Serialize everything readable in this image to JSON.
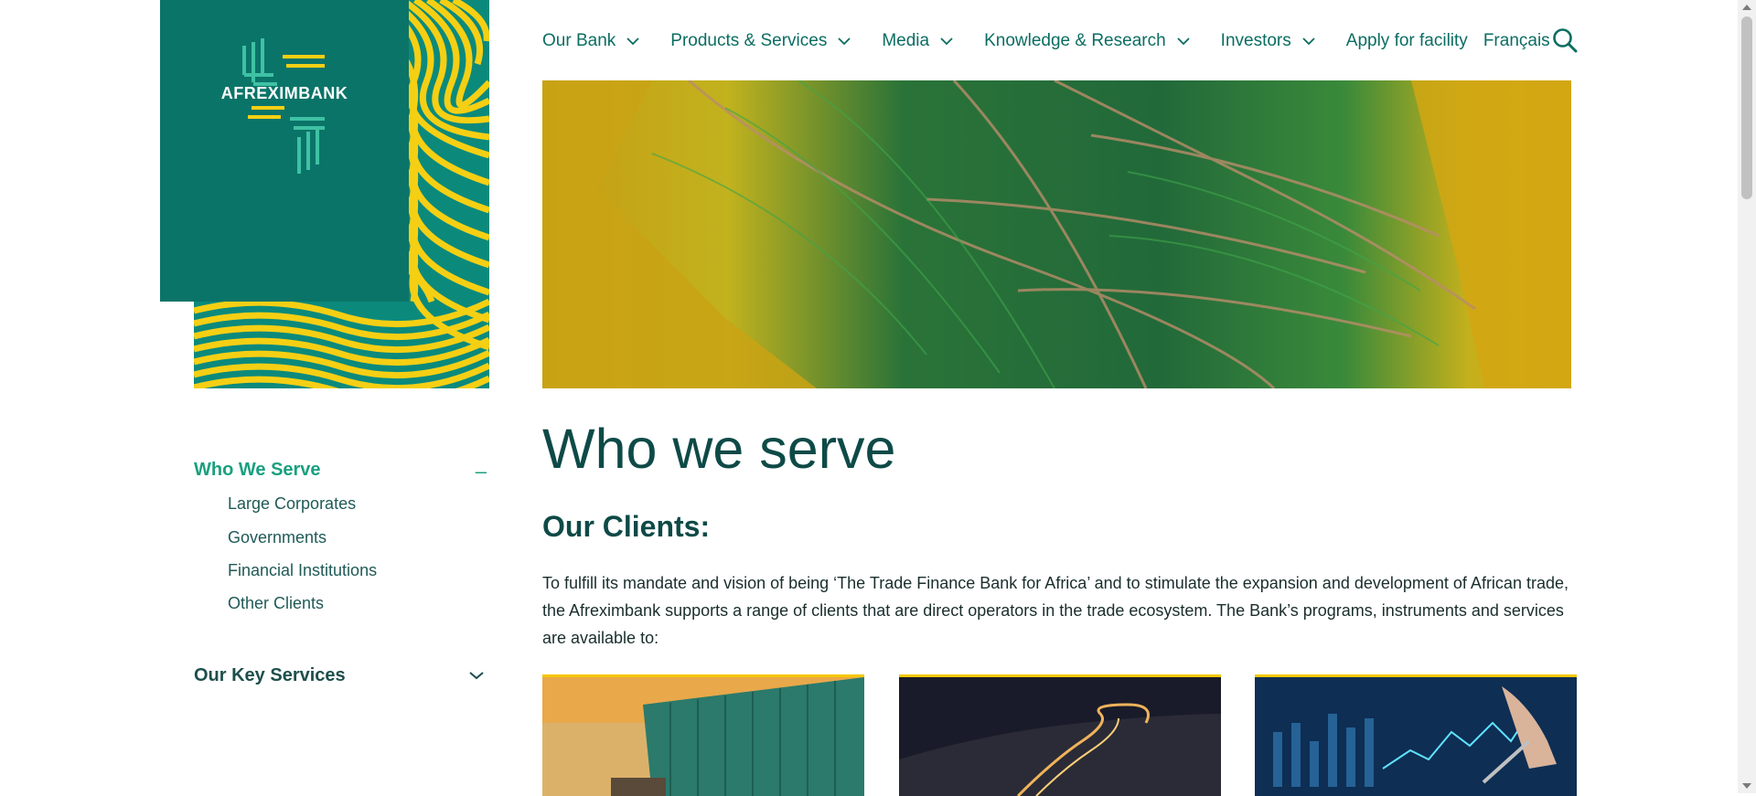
{
  "brand": {
    "name": "AFREXIMBANK"
  },
  "nav": {
    "items": [
      {
        "label": "Our Bank",
        "has_dropdown": true
      },
      {
        "label": "Products & Services",
        "has_dropdown": true
      },
      {
        "label": "Media",
        "has_dropdown": true
      },
      {
        "label": "Knowledge & Research",
        "has_dropdown": true
      },
      {
        "label": "Investors",
        "has_dropdown": true
      },
      {
        "label": "Apply for facility",
        "has_dropdown": false
      },
      {
        "label": "Français",
        "has_dropdown": false
      }
    ],
    "search_icon": "search-icon"
  },
  "sidebar": {
    "section1": {
      "title": "Who We Serve",
      "toggle": "–",
      "items": [
        "Large Corporates",
        "Governments",
        "Financial Institutions",
        "Other Clients"
      ]
    },
    "section2": {
      "title": "Our Key Services",
      "icon": "chevron-down-icon"
    }
  },
  "main": {
    "title": "Who we serve",
    "subtitle": "Our Clients:",
    "intro": "To fulfill its mandate and vision of being ‘The Trade Finance Bank for Africa’ and to stimulate the expansion and development of African trade, the Afreximbank supports a range of clients that are direct operators in the trade ecosystem. The Bank’s programs, instruments and services are available to:"
  },
  "colors": {
    "brand_teal": "#0b7468",
    "accent_yellow": "#f5cf14",
    "link_teal": "#0b6d62",
    "active_green": "#19a07f"
  }
}
